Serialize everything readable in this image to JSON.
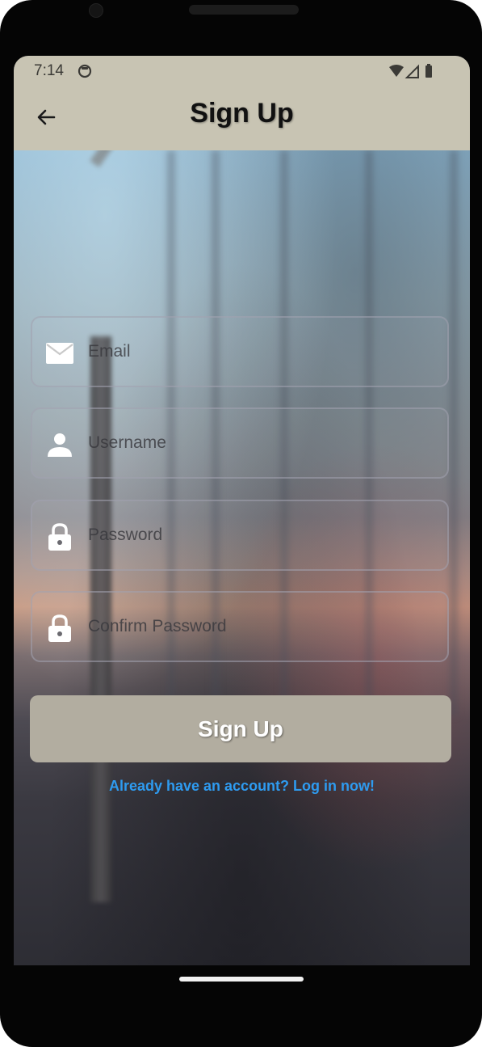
{
  "status_bar": {
    "time": "7:14",
    "icons": [
      "sync-icon",
      "wifi-icon",
      "signal-icon",
      "battery-icon"
    ]
  },
  "app_bar": {
    "title": "Sign Up",
    "back_icon": "arrow-back-icon"
  },
  "form": {
    "email": {
      "placeholder": "Email",
      "icon": "mail-icon"
    },
    "username": {
      "placeholder": "Username",
      "icon": "person-icon"
    },
    "password": {
      "placeholder": "Password",
      "icon": "lock-icon"
    },
    "confirm_password": {
      "placeholder": "Confirm Password",
      "icon": "lock-icon"
    }
  },
  "signup_button": {
    "label": "Sign Up"
  },
  "login_link": {
    "text": "Already have an account? Log in now!"
  },
  "colors": {
    "app_bar": "#c8c4b3",
    "button": "#b2ada0",
    "link": "#2e9bf0"
  }
}
